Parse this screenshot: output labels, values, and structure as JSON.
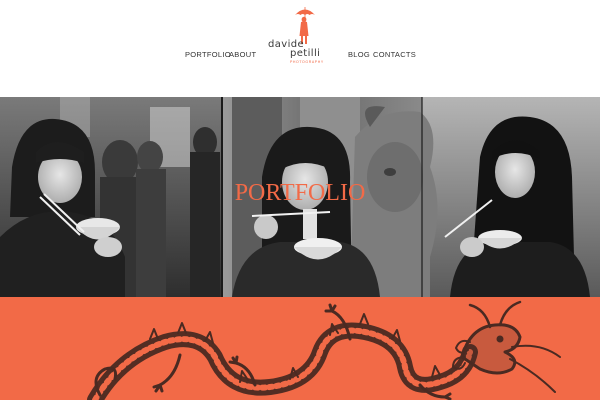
{
  "nav": {
    "portfolio": "PORTFOLIO",
    "about": "ABOUT",
    "blog": "BLOG",
    "contacts": "CONTACTS"
  },
  "logo": {
    "line1": "davide",
    "line2": "petilli",
    "tagline": "PHOTOGRAPHY",
    "icon": "umbrella-figure-icon"
  },
  "hero": {
    "title": "PORTFOLIO"
  },
  "band": {
    "image": "dragon-illustration"
  },
  "colors": {
    "accent": "#f26a47",
    "text": "#333333",
    "band": "#f26a47",
    "dragon": "#4a2a22"
  }
}
